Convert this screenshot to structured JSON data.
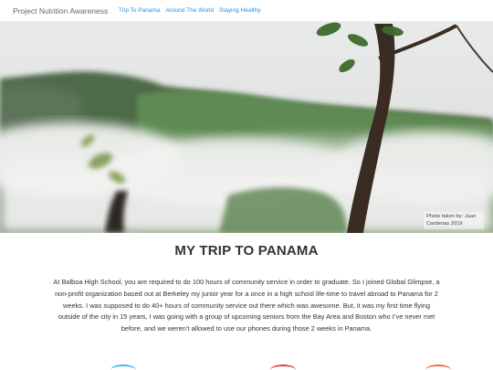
{
  "header": {
    "brand": "Project Nutrition Awareness",
    "nav": [
      {
        "label": "Trip To Panama"
      },
      {
        "label": "Around The World"
      },
      {
        "label": "Staying Healthy"
      }
    ]
  },
  "hero": {
    "caption": "Photo taken by: Juan Cardenas 2019"
  },
  "main": {
    "title": "MY TRIP TO PANAMA",
    "paragraph": "At Balboa High School, you are required to do 100 hours of community service in order to graduate. So I joined Global Glimpse, a non-profit organization based out at Berkeley my junior year for a once in a high school life-time to travel abroad to Panama for 2 weeks. I was supposed to do 40+ hours of community service out there which was awesome. But, it was my first time flying outside of the city in 15 years, I was going with a group of upcoming seniors from the Bay Area and Boston who I’ve never met before, and we weren’t allowed to use our phones during those 2 weeks in Panama."
  },
  "colors": {
    "link": "#2a8ed8",
    "arc_left": "#4db6e6",
    "arc_mid": "#e0463c",
    "arc_right": "#e8733a"
  }
}
